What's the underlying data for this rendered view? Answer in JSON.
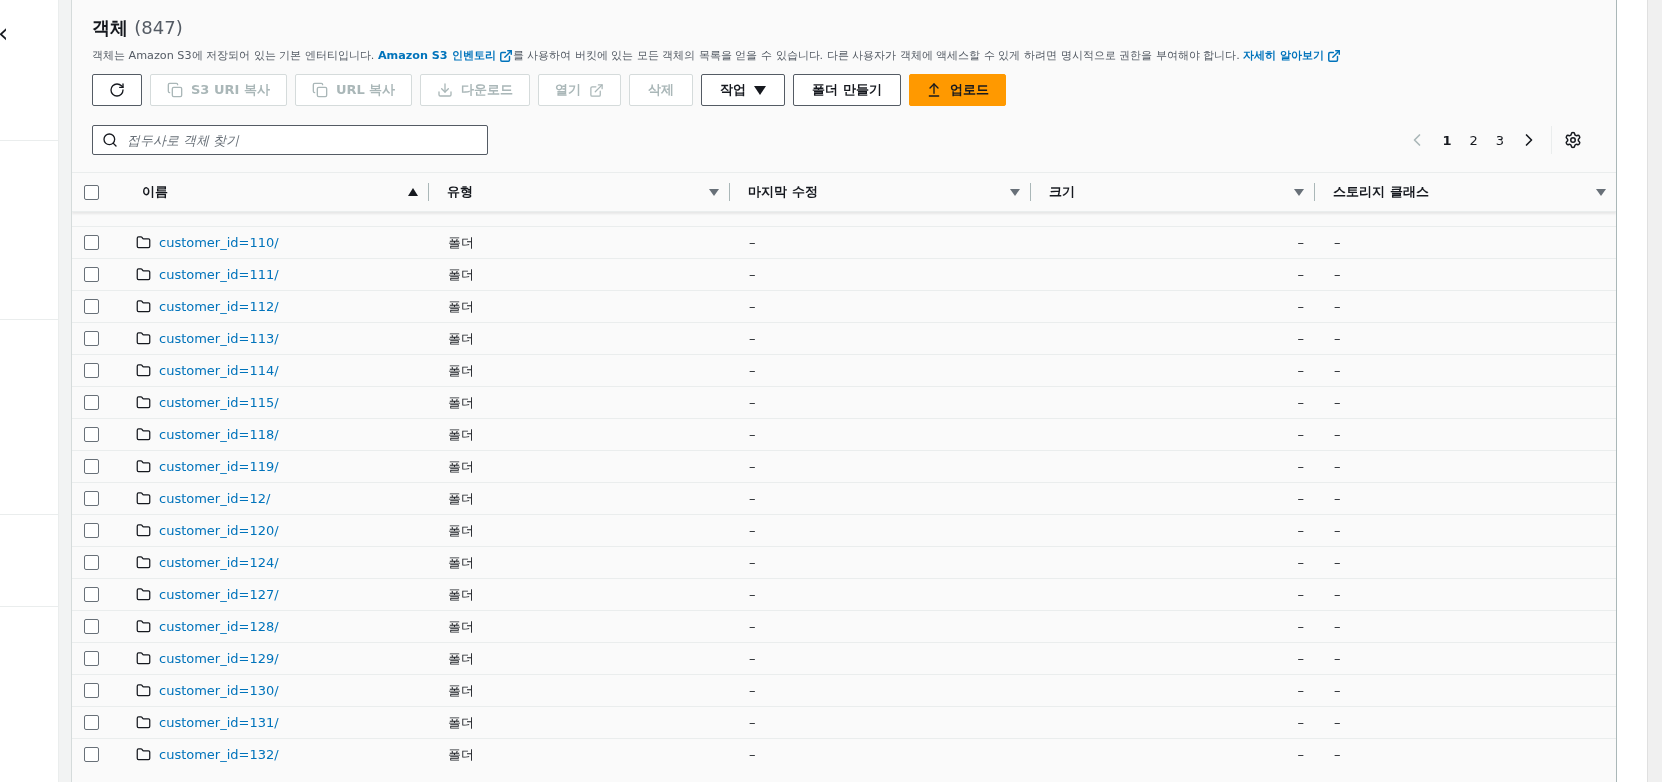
{
  "nav": {
    "collapse_icon": "‹"
  },
  "objects": {
    "title": "객체",
    "count": "(847)",
    "description": [
      {
        "kind": "text",
        "text": "객체는 Amazon S3에 저장되어 있는 기본 엔터티입니다. "
      },
      {
        "kind": "link",
        "text": "Amazon S3 인벤토리"
      },
      {
        "kind": "text",
        "text": "를 사용하여 버킷에 있는 모든 객체의 목록을 얻을 수 있습니다. 다른 사용자가 객체에 액세스할 수 있게 하려면 명시적으로 권한을 부여해야 합니다. "
      },
      {
        "kind": "link",
        "text": "자세히 알아보기"
      }
    ],
    "toolbar": [
      {
        "kind": "refresh",
        "disabled": false
      },
      {
        "kind": "copy",
        "label": "S3 URI 복사",
        "disabled": true
      },
      {
        "kind": "copy",
        "label": "URL 복사",
        "disabled": true
      },
      {
        "kind": "download",
        "label": "다운로드",
        "disabled": true
      },
      {
        "kind": "open",
        "label": "열기",
        "disabled": true
      },
      {
        "kind": "plain",
        "label": "삭제",
        "disabled": true
      },
      {
        "kind": "dropdown",
        "label": "작업",
        "disabled": false
      },
      {
        "kind": "plain",
        "label": "폴더 만들기",
        "disabled": false
      },
      {
        "kind": "primary",
        "label": "업로드",
        "disabled": false
      }
    ],
    "search": {
      "placeholder": "접두사로 객체 찾기"
    },
    "pagination": {
      "pages": [
        {
          "label": "1",
          "selected": true
        },
        {
          "label": "2",
          "selected": false
        },
        {
          "label": "3",
          "selected": false
        }
      ]
    },
    "table": {
      "select_all": {
        "checked": false
      },
      "columns": [
        {
          "label": "이름",
          "sorted": true
        },
        {
          "label": "유형",
          "sorted": false
        },
        {
          "label": "마지막 수정",
          "sorted": false
        },
        {
          "label": "크기",
          "sorted": false
        },
        {
          "label": "스토리지 클래스",
          "sorted": false
        }
      ],
      "rows": [
        {
          "name": "customer_id=110/",
          "type": "폴더",
          "modified": "–",
          "size": "–",
          "storage": "–",
          "checked": false
        },
        {
          "name": "customer_id=111/",
          "type": "폴더",
          "modified": "–",
          "size": "–",
          "storage": "–",
          "checked": false
        },
        {
          "name": "customer_id=112/",
          "type": "폴더",
          "modified": "–",
          "size": "–",
          "storage": "–",
          "checked": false
        },
        {
          "name": "customer_id=113/",
          "type": "폴더",
          "modified": "–",
          "size": "–",
          "storage": "–",
          "checked": false
        },
        {
          "name": "customer_id=114/",
          "type": "폴더",
          "modified": "–",
          "size": "–",
          "storage": "–",
          "checked": false
        },
        {
          "name": "customer_id=115/",
          "type": "폴더",
          "modified": "–",
          "size": "–",
          "storage": "–",
          "checked": false
        },
        {
          "name": "customer_id=118/",
          "type": "폴더",
          "modified": "–",
          "size": "–",
          "storage": "–",
          "checked": false
        },
        {
          "name": "customer_id=119/",
          "type": "폴더",
          "modified": "–",
          "size": "–",
          "storage": "–",
          "checked": false
        },
        {
          "name": "customer_id=12/",
          "type": "폴더",
          "modified": "–",
          "size": "–",
          "storage": "–",
          "checked": false
        },
        {
          "name": "customer_id=120/",
          "type": "폴더",
          "modified": "–",
          "size": "–",
          "storage": "–",
          "checked": false
        },
        {
          "name": "customer_id=124/",
          "type": "폴더",
          "modified": "–",
          "size": "–",
          "storage": "–",
          "checked": false
        },
        {
          "name": "customer_id=127/",
          "type": "폴더",
          "modified": "–",
          "size": "–",
          "storage": "–",
          "checked": false
        },
        {
          "name": "customer_id=128/",
          "type": "폴더",
          "modified": "–",
          "size": "–",
          "storage": "–",
          "checked": false
        },
        {
          "name": "customer_id=129/",
          "type": "폴더",
          "modified": "–",
          "size": "–",
          "storage": "–",
          "checked": false
        },
        {
          "name": "customer_id=130/",
          "type": "폴더",
          "modified": "–",
          "size": "–",
          "storage": "–",
          "checked": false
        },
        {
          "name": "customer_id=131/",
          "type": "폴더",
          "modified": "–",
          "size": "–",
          "storage": "–",
          "checked": false
        },
        {
          "name": "customer_id=132/",
          "type": "폴더",
          "modified": "–",
          "size": "–",
          "storage": "–",
          "checked": false
        }
      ]
    }
  }
}
